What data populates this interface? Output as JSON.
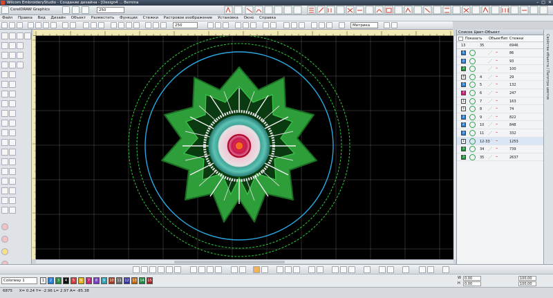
{
  "window": {
    "title": "Wilcom EmbroideryStudio - Создание дизайна - [Design4 ...      Bernina"
  },
  "ribbon": {
    "app_switch": "CorelDRAW Graphics",
    "zoom_value": "250"
  },
  "menu": {
    "items": [
      "Файл",
      "Правка",
      "Вид",
      "Дизайн",
      "Объект",
      "Разместить",
      "Функции",
      "Стежки",
      "Растровое изображение",
      "Установка",
      "Окно",
      "Справка"
    ]
  },
  "toolbar2": {
    "zoom_value": "250",
    "units": "Метрика"
  },
  "panel": {
    "title": "Список Цвет-Объект",
    "side_tab_label": "Свойства объекта / Палитра цветов",
    "header": {
      "show": "Показать",
      "objects": "Объект",
      "type": "Тип",
      "stitches": "Стежки"
    },
    "summary": {
      "colors": "13",
      "objects": "35",
      "stitches": "6946"
    },
    "rows": [
      {
        "color_num": "1",
        "color": "#2a7fd4",
        "objects": "",
        "stitches": "86",
        "selected": false
      },
      {
        "color_num": "2",
        "color": "#2a7fd4",
        "objects": "",
        "stitches": "93",
        "selected": false
      },
      {
        "color_num": "3",
        "color": "#1f8f3a",
        "objects": "",
        "stitches": "100",
        "selected": false
      },
      {
        "color_num": "4",
        "color": "#f0f0f0",
        "objects": "4",
        "stitches": "29",
        "selected": false
      },
      {
        "color_num": "5",
        "color": "#2a7fd4",
        "objects": "5",
        "stitches": "132",
        "selected": false
      },
      {
        "color_num": "7",
        "color": "#d0207a",
        "objects": "6",
        "stitches": "247",
        "selected": false
      },
      {
        "color_num": "1",
        "color": "#f0f0f0",
        "objects": "7",
        "stitches": "163",
        "selected": false
      },
      {
        "color_num": "1",
        "color": "#f0f0f0",
        "objects": "8",
        "stitches": "74",
        "selected": false
      },
      {
        "color_num": "2",
        "color": "#2a7fd4",
        "objects": "9",
        "stitches": "822",
        "selected": false
      },
      {
        "color_num": "2",
        "color": "#2a7fd4",
        "objects": "10",
        "stitches": "848",
        "selected": false
      },
      {
        "color_num": "2",
        "color": "#2a7fd4",
        "objects": "11",
        "stitches": "332",
        "selected": false
      },
      {
        "color_num": "1",
        "color": "#f0f0f0",
        "objects": "12-33",
        "stitches": "1253",
        "selected": true
      },
      {
        "color_num": "3",
        "color": "#1f8f3a",
        "objects": "34",
        "stitches": "739",
        "selected": false
      },
      {
        "color_num": "3",
        "color": "#1f8f3a",
        "objects": "35",
        "stitches": "2637",
        "selected": false
      }
    ]
  },
  "colorbar": {
    "colorway": "Colorway 1",
    "swatches": [
      {
        "label": "1",
        "color": "#f2f2f2"
      },
      {
        "label": "2",
        "color": "#2a7fd4"
      },
      {
        "label": "3",
        "color": "#1f8f3a"
      },
      {
        "label": "4",
        "color": "#111111"
      },
      {
        "label": "5",
        "color": "#d63a3a"
      },
      {
        "label": "6",
        "color": "#e8b020"
      },
      {
        "label": "7",
        "color": "#d0207a"
      },
      {
        "label": "8",
        "color": "#7a3fc0"
      },
      {
        "label": "9",
        "color": "#2aa6b8"
      },
      {
        "label": "10",
        "color": "#a04020"
      },
      {
        "label": "11",
        "color": "#6b6b6b"
      },
      {
        "label": "12",
        "color": "#333399"
      },
      {
        "label": "13",
        "color": "#cc6600"
      },
      {
        "label": "14",
        "color": "#228844"
      },
      {
        "label": "15",
        "color": "#aa2222"
      }
    ],
    "w_label": "W",
    "w_value": "0.00",
    "h_label": "H",
    "h_value": "0.00",
    "scale_w": "100.00",
    "scale_h": "100.00"
  },
  "status": {
    "stitches": "6875",
    "x": "X= 0.24 Y= -2.96 L= 2.97 A= -85.38"
  }
}
